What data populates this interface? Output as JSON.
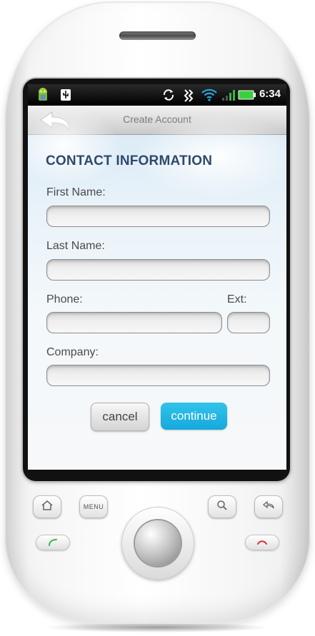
{
  "status_bar": {
    "time": "6:34",
    "icons": [
      "android-icon",
      "usb-icon",
      "sync-icon",
      "vibrate-icon",
      "wifi-icon",
      "signal-icon",
      "battery-icon"
    ]
  },
  "title_bar": {
    "title": "Create Account",
    "back_icon": "back-arrow-icon"
  },
  "form": {
    "heading": "CONTACT INFORMATION",
    "first_name": {
      "label": "First Name:",
      "value": ""
    },
    "last_name": {
      "label": "Last Name:",
      "value": ""
    },
    "phone": {
      "label": "Phone:",
      "value": ""
    },
    "ext": {
      "label": "Ext:",
      "value": ""
    },
    "company": {
      "label": "Company:",
      "value": ""
    }
  },
  "buttons": {
    "cancel": "cancel",
    "continue": "continue"
  },
  "hardware_keys": {
    "home_icon": "home-icon",
    "menu_label": "MENU",
    "search_icon": "search-icon",
    "back_icon": "back-icon",
    "call_icon": "call-icon",
    "end_call_icon": "end-call-icon"
  },
  "colors": {
    "accent": "#1aaee0",
    "heading": "#2f4a6b",
    "call_green": "#3cb44a",
    "end_red": "#d9313a"
  }
}
